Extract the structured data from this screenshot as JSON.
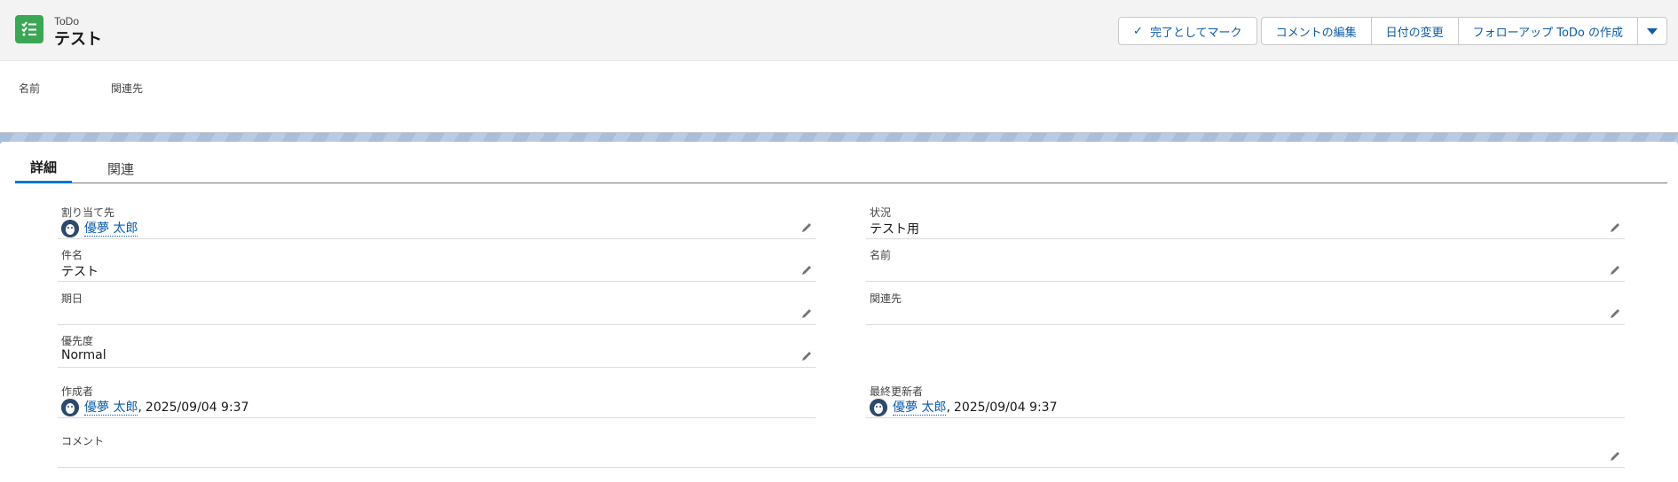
{
  "header": {
    "object_type": "ToDo",
    "record_title": "テスト",
    "actions": {
      "mark_complete": "完了としてマーク",
      "edit_comment": "コメントの編集",
      "change_date": "日付の変更",
      "create_followup": "フォローアップ ToDo の作成"
    },
    "highlights": {
      "name_label": "名前",
      "related_label": "関連先"
    }
  },
  "tabs": {
    "details": "詳細",
    "related": "関連"
  },
  "fields": {
    "assigned_to": {
      "label": "割り当て先",
      "value": "優夢 太郎"
    },
    "status": {
      "label": "状況",
      "value": "テスト用"
    },
    "subject": {
      "label": "件名",
      "value": "テスト"
    },
    "name": {
      "label": "名前",
      "value": ""
    },
    "due_date": {
      "label": "期日",
      "value": ""
    },
    "related_to": {
      "label": "関連先",
      "value": ""
    },
    "priority": {
      "label": "優先度",
      "value": "Normal"
    },
    "created_by": {
      "label": "作成者",
      "user": "優夢 太郎",
      "separator": ",",
      "datetime": "2025/09/04 9:37"
    },
    "last_modified_by": {
      "label": "最終更新者",
      "user": "優夢 太郎",
      "separator": ",",
      "datetime": "2025/09/04 9:37"
    },
    "comment": {
      "label": "コメント",
      "value": ""
    }
  },
  "colors": {
    "brand": "#0176d3",
    "link": "#0b5cab",
    "todo_icon": "#3ba755"
  },
  "icons": {
    "object_icon": "task-checklist-icon",
    "edit_icon": "pencil-icon",
    "check_icon": "check-icon",
    "dropdown_icon": "chevron-down-icon",
    "avatar_icon": "user-avatar-icon"
  }
}
